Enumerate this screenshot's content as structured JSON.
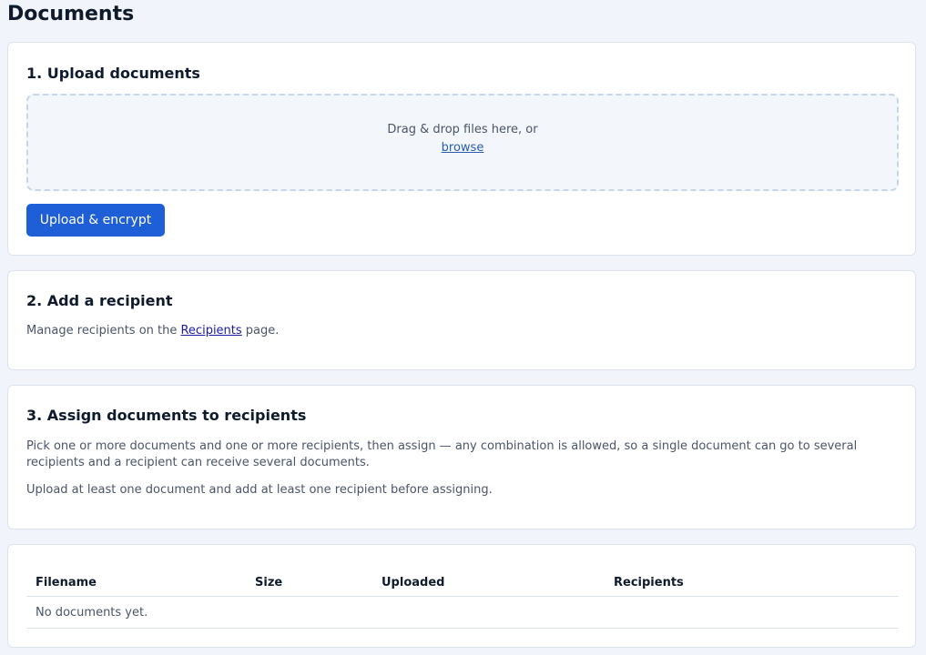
{
  "page": {
    "title": "Documents"
  },
  "upload": {
    "heading": "1. Upload documents",
    "dropzone_text": "Drag & drop files here, or",
    "browse_label": "browse",
    "button_label": "Upload & encrypt"
  },
  "recipient": {
    "heading": "2. Add a recipient",
    "text_before": "Manage recipients on the ",
    "link_label": "Recipients",
    "text_after": " page."
  },
  "assign": {
    "heading": "3. Assign documents to recipients",
    "description": "Pick one or more documents and one or more recipients, then assign — any combination is allowed, so a single document can go to several recipients and a recipient can receive several documents.",
    "hint": "Upload at least one document and add at least one recipient before assigning."
  },
  "table": {
    "columns": [
      "Filename",
      "Size",
      "Uploaded",
      "Recipients"
    ],
    "empty_message": "No documents yet."
  },
  "colors": {
    "primary": "#1e5fd8",
    "background": "#f1f5fb",
    "card": "#ffffff",
    "border": "#dbe3ef"
  }
}
